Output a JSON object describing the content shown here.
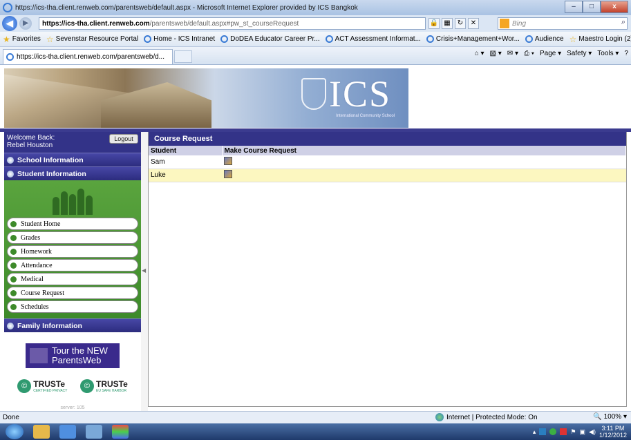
{
  "window": {
    "title": "https://ics-tha.client.renweb.com/parentsweb/default.aspx - Microsoft Internet Explorer provided by ICS Bangkok",
    "minimize": "–",
    "maximize": "□",
    "close": "x"
  },
  "address_bar": {
    "url_host": "https://ics-tha.client.renweb.com",
    "url_path": "/parentsweb/default.aspx#pw_st_courseRequest",
    "search_placeholder": "Bing"
  },
  "favorites_bar": {
    "label": "Favorites",
    "items": [
      "Sevenstar Resource Portal",
      "Home - ICS Intranet",
      "DoDEA Educator Career Pr...",
      "ACT Assessment Informat...",
      "Crisis+Management+Wor...",
      "Audience",
      "Maestro Login (2)"
    ]
  },
  "tab": {
    "title": "https://ics-tha.client.renweb.com/parentsweb/d..."
  },
  "command_bar": {
    "page": "Page ▾",
    "safety": "Safety ▾",
    "tools": "Tools ▾"
  },
  "banner": {
    "logo_text": "ICS",
    "logo_subtitle": "International Community School"
  },
  "sidebar": {
    "welcome_label": "Welcome Back:",
    "user_name": "Rebel Houston",
    "logout_label": "Logout",
    "sections": {
      "school_info": "School Information",
      "student_info": "Student Information",
      "family_info": "Family Information"
    },
    "menu": [
      "Student Home",
      "Grades",
      "Homework",
      "Attendance",
      "Medical",
      "Course Request",
      "Schedules"
    ],
    "tour_line1": "Tour the NEW",
    "tour_line2": "ParentsWeb",
    "truste1_word": "TRUSTe",
    "truste1_sub": "CERTIFIED PRIVACY",
    "truste2_word": "TRUSTe",
    "truste2_sub": "EU SAFE HARBOR",
    "server": "server: 105"
  },
  "main": {
    "header": "Course Request",
    "columns": [
      "Student",
      "Make Course Request"
    ],
    "rows": [
      {
        "student": "Sam"
      },
      {
        "student": "Luke"
      }
    ]
  },
  "status_bar": {
    "left": "Done",
    "zone": "Internet | Protected Mode: On",
    "zoom": "100%"
  },
  "taskbar": {
    "time": "3:11 PM",
    "date": "1/12/2012"
  },
  "colors": {
    "nav_blue": "#333388",
    "sidebar_green": "#3d8a2a",
    "highlight_row": "#fcf7c0"
  }
}
